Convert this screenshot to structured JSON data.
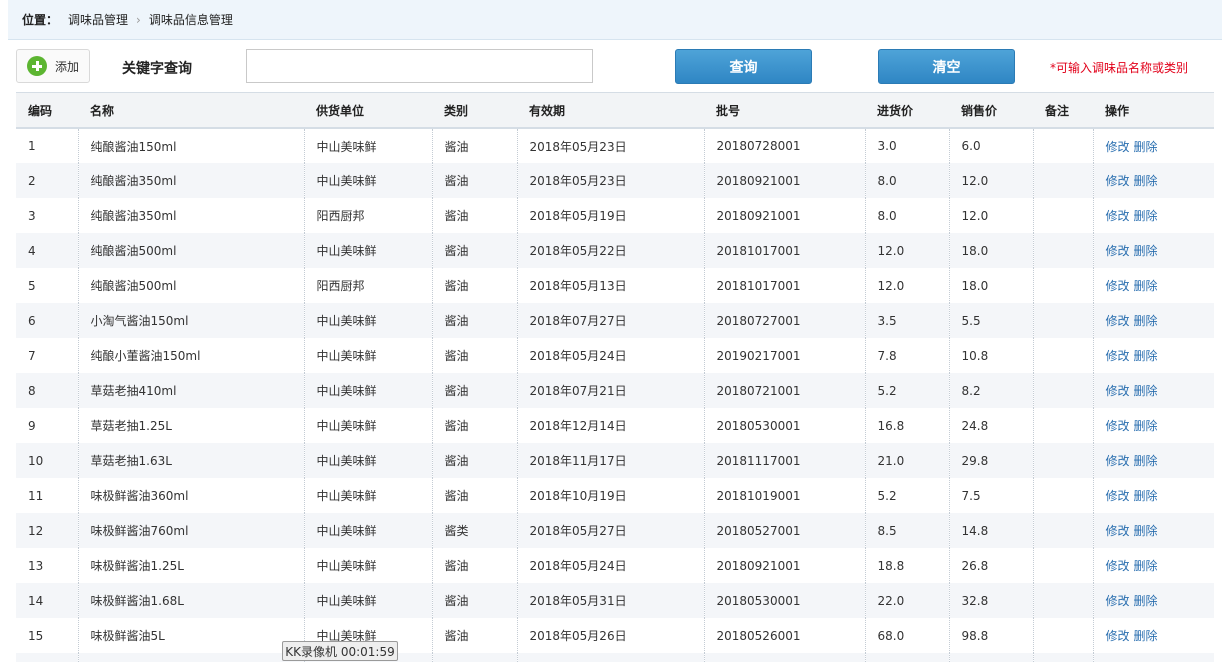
{
  "breadcrumb": {
    "label": "位置：",
    "items": [
      "调味品管理",
      "调味品信息管理"
    ],
    "separator": "›"
  },
  "toolbar": {
    "add_label": "添加",
    "keyword_label": "关键字查询",
    "search_value": "",
    "search_placeholder": "",
    "query_label": "查询",
    "clear_label": "清空",
    "hint": "*可输入调味品名称或类别"
  },
  "table": {
    "headers": [
      "编码",
      "名称",
      "供货单位",
      "类别",
      "有效期",
      "批号",
      "进货价",
      "销售价",
      "备注",
      "操作"
    ],
    "rows": [
      {
        "id": "1",
        "name": "纯酿酱油150ml",
        "supplier": "中山美味鲜",
        "category": "酱油",
        "expiry": "2018年05月23日",
        "batch": "20180728001",
        "cost": "3.0",
        "price": "6.0",
        "note": "",
        "edit": "修改",
        "delete": "删除"
      },
      {
        "id": "2",
        "name": "纯酿酱油350ml",
        "supplier": "中山美味鲜",
        "category": "酱油",
        "expiry": "2018年05月23日",
        "batch": "20180921001",
        "cost": "8.0",
        "price": "12.0",
        "note": "",
        "edit": "修改",
        "delete": "删除"
      },
      {
        "id": "3",
        "name": "纯酿酱油350ml",
        "supplier": "阳西厨邦",
        "category": "酱油",
        "expiry": "2018年05月19日",
        "batch": "20180921001",
        "cost": "8.0",
        "price": "12.0",
        "note": "",
        "edit": "修改",
        "delete": "删除"
      },
      {
        "id": "4",
        "name": "纯酿酱油500ml",
        "supplier": "中山美味鲜",
        "category": "酱油",
        "expiry": "2018年05月22日",
        "batch": "20181017001",
        "cost": "12.0",
        "price": "18.0",
        "note": "",
        "edit": "修改",
        "delete": "删除"
      },
      {
        "id": "5",
        "name": "纯酿酱油500ml",
        "supplier": "阳西厨邦",
        "category": "酱油",
        "expiry": "2018年05月13日",
        "batch": "20181017001",
        "cost": "12.0",
        "price": "18.0",
        "note": "",
        "edit": "修改",
        "delete": "删除"
      },
      {
        "id": "6",
        "name": "小淘气酱油150ml",
        "supplier": "中山美味鲜",
        "category": "酱油",
        "expiry": "2018年07月27日",
        "batch": "20180727001",
        "cost": "3.5",
        "price": "5.5",
        "note": "",
        "edit": "修改",
        "delete": "删除"
      },
      {
        "id": "7",
        "name": "纯酿小董酱油150ml",
        "supplier": "中山美味鲜",
        "category": "酱油",
        "expiry": "2018年05月24日",
        "batch": "20190217001",
        "cost": "7.8",
        "price": "10.8",
        "note": "",
        "edit": "修改",
        "delete": "删除"
      },
      {
        "id": "8",
        "name": "草菇老抽410ml",
        "supplier": "中山美味鲜",
        "category": "酱油",
        "expiry": "2018年07月21日",
        "batch": "20180721001",
        "cost": "5.2",
        "price": "8.2",
        "note": "",
        "edit": "修改",
        "delete": "删除"
      },
      {
        "id": "9",
        "name": "草菇老抽1.25L",
        "supplier": "中山美味鲜",
        "category": "酱油",
        "expiry": "2018年12月14日",
        "batch": "20180530001",
        "cost": "16.8",
        "price": "24.8",
        "note": "",
        "edit": "修改",
        "delete": "删除"
      },
      {
        "id": "10",
        "name": "草菇老抽1.63L",
        "supplier": "中山美味鲜",
        "category": "酱油",
        "expiry": "2018年11月17日",
        "batch": "20181117001",
        "cost": "21.0",
        "price": "29.8",
        "note": "",
        "edit": "修改",
        "delete": "删除"
      },
      {
        "id": "11",
        "name": "味极鲜酱油360ml",
        "supplier": "中山美味鲜",
        "category": "酱油",
        "expiry": "2018年10月19日",
        "batch": "20181019001",
        "cost": "5.2",
        "price": "7.5",
        "note": "",
        "edit": "修改",
        "delete": "删除"
      },
      {
        "id": "12",
        "name": "味极鲜酱油760ml",
        "supplier": "中山美味鲜",
        "category": "酱类",
        "expiry": "2018年05月27日",
        "batch": "20180527001",
        "cost": "8.5",
        "price": "14.8",
        "note": "",
        "edit": "修改",
        "delete": "删除"
      },
      {
        "id": "13",
        "name": "味极鲜酱油1.25L",
        "supplier": "中山美味鲜",
        "category": "酱油",
        "expiry": "2018年05月24日",
        "batch": "20180921001",
        "cost": "18.8",
        "price": "26.8",
        "note": "",
        "edit": "修改",
        "delete": "删除"
      },
      {
        "id": "14",
        "name": "味极鲜酱油1.68L",
        "supplier": "中山美味鲜",
        "category": "酱油",
        "expiry": "2018年05月31日",
        "batch": "20180530001",
        "cost": "22.0",
        "price": "32.8",
        "note": "",
        "edit": "修改",
        "delete": "删除"
      },
      {
        "id": "15",
        "name": "味极鲜酱油5L",
        "supplier": "中山美味鲜",
        "category": "酱油",
        "expiry": "2018年05月26日",
        "batch": "20180526001",
        "cost": "68.0",
        "price": "98.8",
        "note": "",
        "edit": "修改",
        "delete": "删除"
      },
      {
        "id": "",
        "name": "",
        "supplier": "",
        "category": "",
        "expiry": "",
        "batch": "",
        "cost": "",
        "price": "",
        "note": "",
        "edit": "",
        "delete": ""
      }
    ]
  },
  "overlay": {
    "recorder_text": "KK录像机 00:01:59"
  },
  "colors": {
    "accent_blue": "#2f86c4",
    "hint_red": "#e2001a",
    "link_blue": "#2a6fb0",
    "add_green": "#5cb531"
  }
}
